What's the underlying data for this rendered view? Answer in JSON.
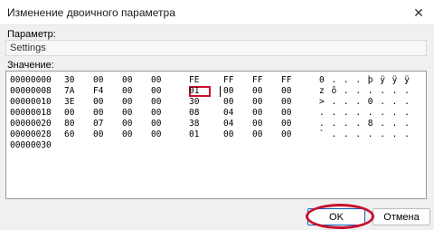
{
  "window": {
    "title": "Изменение двоичного параметра",
    "close_glyph": "✕"
  },
  "labels": {
    "param": "Параметр:",
    "value": "Значение:"
  },
  "param_value": "Settings",
  "hex": {
    "rows": [
      {
        "addr": "00000000",
        "bytes": [
          "30",
          "00",
          "00",
          "00",
          "FE",
          "FF",
          "FF",
          "FF"
        ],
        "ascii": "0 . . . þ ÿ ÿ ÿ"
      },
      {
        "addr": "00000008",
        "bytes": [
          "7A",
          "F4",
          "00",
          "00",
          "01",
          "00",
          "00",
          "00"
        ],
        "ascii": "z ô . . . . . ."
      },
      {
        "addr": "00000010",
        "bytes": [
          "3E",
          "00",
          "00",
          "00",
          "30",
          "00",
          "00",
          "00"
        ],
        "ascii": "> . . . 0 . . ."
      },
      {
        "addr": "00000018",
        "bytes": [
          "00",
          "00",
          "00",
          "00",
          "08",
          "04",
          "00",
          "00"
        ],
        "ascii": ". . . . . . . ."
      },
      {
        "addr": "00000020",
        "bytes": [
          "80",
          "07",
          "00",
          "00",
          "38",
          "04",
          "00",
          "00"
        ],
        "ascii": ". . . . 8 . . ."
      },
      {
        "addr": "00000028",
        "bytes": [
          "60",
          "00",
          "00",
          "00",
          "01",
          "00",
          "00",
          "00"
        ],
        "ascii": "` . . . . . . ."
      },
      {
        "addr": "00000030",
        "bytes": [],
        "ascii": ""
      }
    ]
  },
  "buttons": {
    "ok": "OK",
    "cancel": "Отмена"
  },
  "colors": {
    "highlight": "#c8102e"
  }
}
